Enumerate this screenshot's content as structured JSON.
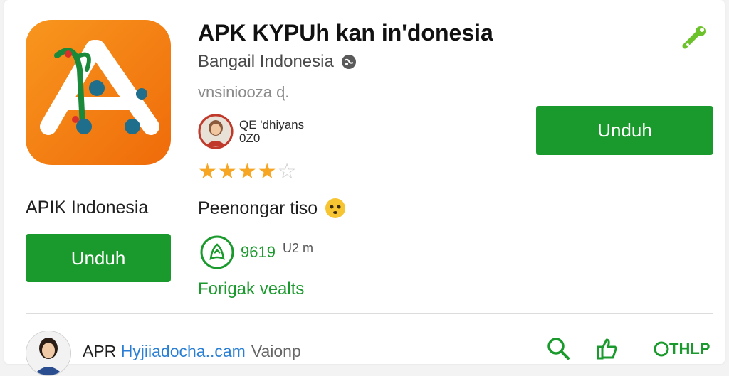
{
  "app": {
    "title": "APK KYPUh kan in'donesia",
    "developer": "Bangail Indonesia",
    "version": "vnsinioozа ɖ.",
    "name_label": "APIK Indonesia",
    "subtitle": "Peenongar tiso",
    "primary_button": "Unduh",
    "secondary_button": "Unduh",
    "rating": 4,
    "rating_max": 5
  },
  "reviewer": {
    "line1": "QE 'dhiyans",
    "line2": "0Z0"
  },
  "stats": {
    "downloads": "9619",
    "unit": "U2 m"
  },
  "link": {
    "label": "Forigak vealts"
  },
  "footer": {
    "text_prefix": "APR ",
    "text_link": "Hyjiiadocha..cam",
    "text_suffix": "Vaionp",
    "help_label": "THLP"
  },
  "icons": {
    "top_right": "wrench-icon",
    "developer": "globe-icon",
    "downloads": "download-badge-icon",
    "search": "search-icon",
    "like": "thumbs-up-icon",
    "help": "help-icon"
  },
  "colors": {
    "accent": "#1a9a2c",
    "star": "#f6a623",
    "icon_orange": "#f47a0e",
    "link_blue": "#2a7fd4"
  }
}
